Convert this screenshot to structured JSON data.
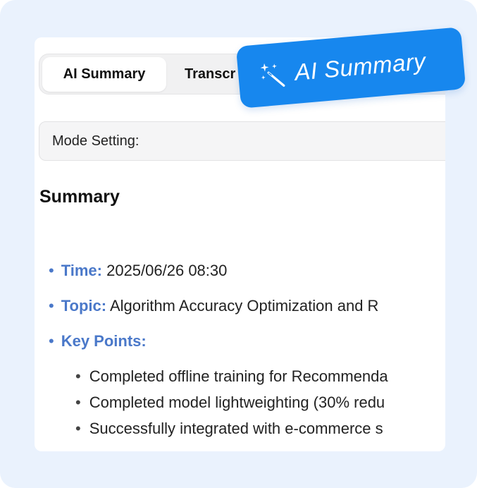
{
  "tabs": {
    "active_label": "AI Summary",
    "inactive_label": "Transcr"
  },
  "mode_setting": {
    "label": "Mode Setting:"
  },
  "summary": {
    "title": "Summary",
    "items": [
      {
        "key": "Time:",
        "value": " 2025/06/26 08:30"
      },
      {
        "key": "Topic:",
        "value": " Algorithm Accuracy Optimization and R"
      },
      {
        "key": "Key Points:",
        "value": ""
      }
    ],
    "key_points": [
      "Completed offline training for Recommenda",
      "Completed model lightweighting (30% redu",
      "Successfully integrated with e-commerce s"
    ]
  },
  "badge": {
    "label": "AI Summary",
    "icon": "magic-wand-icon"
  },
  "colors": {
    "background": "#eaf2fd",
    "accent": "#1787ee",
    "key_text": "#4a78c9"
  }
}
